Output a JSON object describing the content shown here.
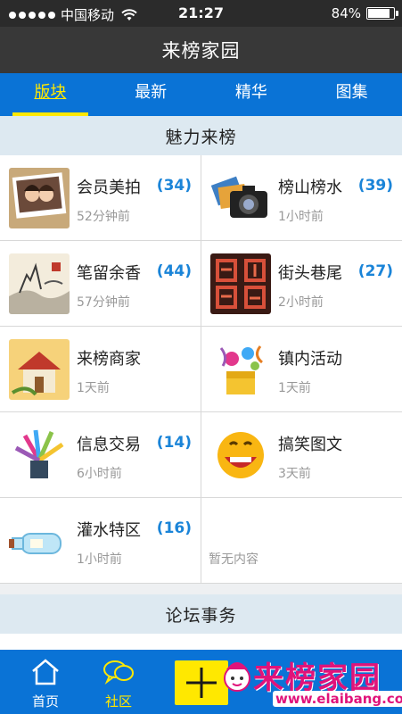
{
  "status_bar": {
    "carrier": "中国移动",
    "time": "21:27",
    "battery": "84%",
    "battery_level": 0.84
  },
  "header": {
    "title": "来榜家园"
  },
  "tabs": [
    {
      "label": "版块",
      "active": true
    },
    {
      "label": "最新",
      "active": false
    },
    {
      "label": "精华",
      "active": false
    },
    {
      "label": "图集",
      "active": false
    }
  ],
  "sections": [
    {
      "title": "魅力来榜"
    },
    {
      "title": "论坛事务"
    }
  ],
  "forums": [
    {
      "name": "会员美拍",
      "count": "(34)",
      "time": "52分钟前",
      "icon": "couple-photo-icon"
    },
    {
      "name": "榜山榜水",
      "count": "(39)",
      "time": "1小时前",
      "icon": "camera-icon"
    },
    {
      "name": "笔留余香",
      "count": "(44)",
      "time": "57分钟前",
      "icon": "ink-painting-icon"
    },
    {
      "name": "街头巷尾",
      "count": "(27)",
      "time": "2小时前",
      "icon": "street-calligraphy-icon"
    },
    {
      "name": "来榜商家",
      "count": "",
      "time": "1天前",
      "icon": "shop-house-icon"
    },
    {
      "name": "镇内活动",
      "count": "",
      "time": "1天前",
      "icon": "gift-box-icon"
    },
    {
      "name": "信息交易",
      "count": "(14)",
      "time": "6小时前",
      "icon": "colorful-burst-icon"
    },
    {
      "name": "搞笑图文",
      "count": "",
      "time": "3天前",
      "icon": "laughing-face-icon"
    },
    {
      "name": "灌水特区",
      "count": "(16)",
      "time": "1小时前",
      "icon": "bottle-icon"
    }
  ],
  "empty_cell": {
    "text": "暂无内容"
  },
  "bottom_nav": [
    {
      "label": "首页",
      "icon": "home-icon",
      "active": false
    },
    {
      "label": "社区",
      "icon": "chat-bubbles-icon",
      "active": true
    }
  ],
  "watermark": {
    "text": "来榜家园",
    "url": "www.elaibang.com"
  },
  "colors": {
    "accent": "#0a73d6",
    "active_tab": "#ffe800",
    "count": "#1a84d8",
    "header": "#383838"
  }
}
